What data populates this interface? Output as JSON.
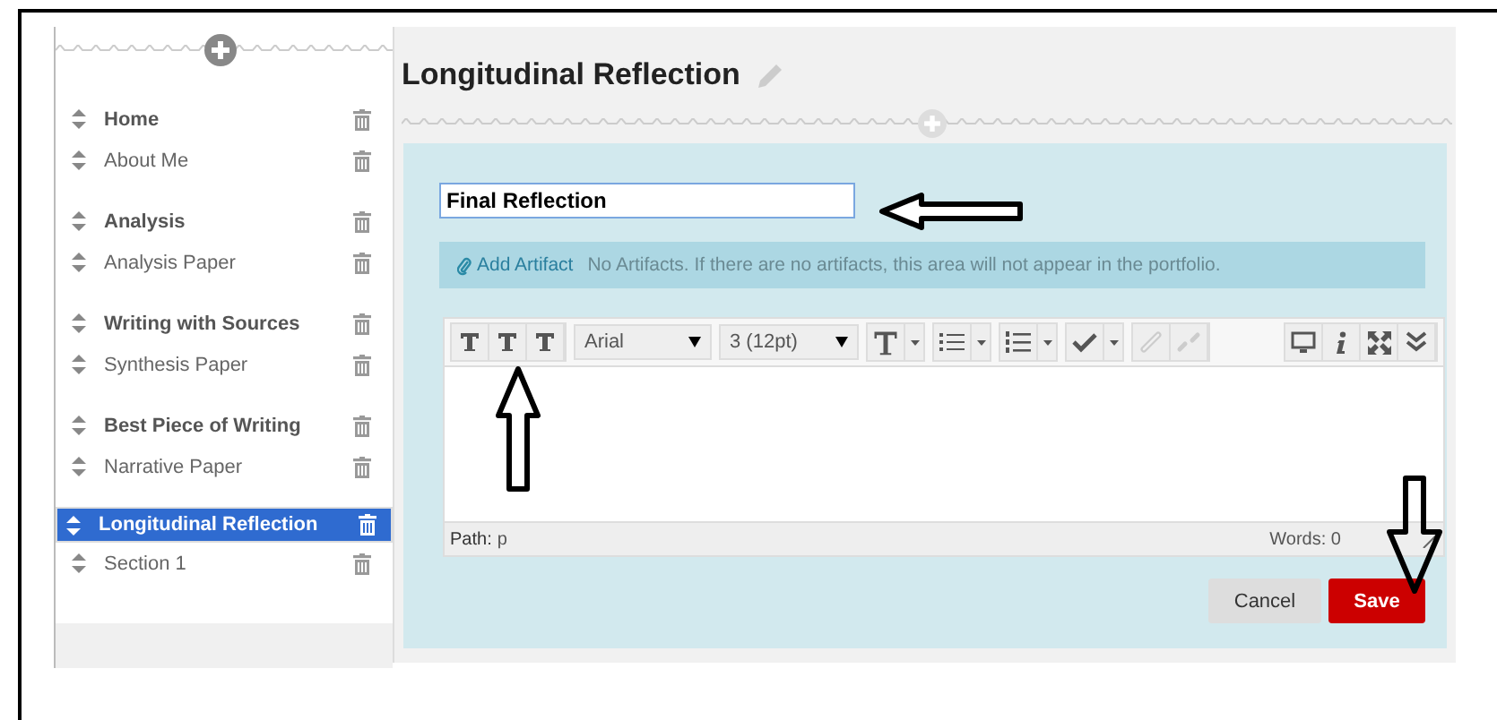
{
  "sidebar": {
    "items": [
      {
        "label": "Home",
        "kind": "heading",
        "selected": false
      },
      {
        "label": "About Me",
        "kind": "page",
        "selected": false
      },
      {
        "label": "Analysis",
        "kind": "heading",
        "selected": false
      },
      {
        "label": "Analysis Paper",
        "kind": "page",
        "selected": false
      },
      {
        "label": "Writing with Sources",
        "kind": "heading",
        "selected": false
      },
      {
        "label": "Synthesis Paper",
        "kind": "page",
        "selected": false
      },
      {
        "label": "Best Piece of Writing",
        "kind": "heading",
        "selected": false
      },
      {
        "label": "Narrative Paper",
        "kind": "page",
        "selected": false
      },
      {
        "label": "Longitudinal Reflection",
        "kind": "heading",
        "selected": true
      },
      {
        "label": "Section 1",
        "kind": "page",
        "selected": false
      }
    ]
  },
  "page_title": "Longitudinal Reflection",
  "title_field": {
    "value": "Final Reflection"
  },
  "artifact_bar": {
    "link": "Add Artifact",
    "message": "No Artifacts. If there are no artifacts, this area will not appear in the portfolio."
  },
  "editor": {
    "font": "Arial",
    "size": "3 (12pt)",
    "path_label": "Path:",
    "path_value": "p",
    "word_count": "Words: 0"
  },
  "buttons": [
    {
      "label": "Cancel",
      "kind": "secondary"
    },
    {
      "label": "Save",
      "kind": "primary"
    }
  ]
}
